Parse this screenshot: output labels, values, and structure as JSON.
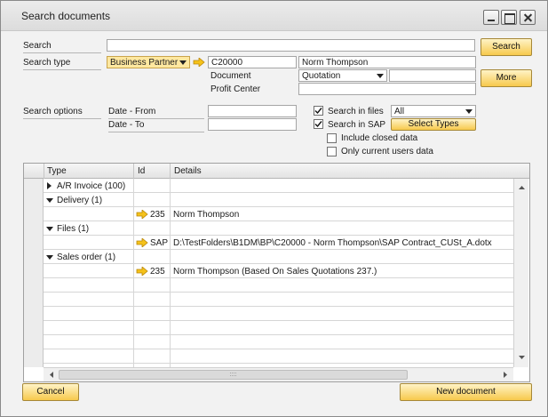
{
  "window": {
    "title": "Search documents"
  },
  "form": {
    "search_label": "Search",
    "search_value": "",
    "search_type_label": "Search type",
    "search_type_value": "Business Partner",
    "bp_code": "C20000",
    "bp_name": "Norm Thompson",
    "document_label": "Document",
    "document_value": "Quotation",
    "document_extra": "",
    "profit_center_label": "Profit Center",
    "profit_center_value": "",
    "search_options_label": "Search options",
    "date_from_label": "Date - From",
    "date_from_value": "",
    "date_to_label": "Date - To",
    "date_to_value": "",
    "search_in_files_label": "Search in files",
    "search_in_files_checked": true,
    "files_filter_value": "All",
    "search_in_sap_label": "Search in SAP",
    "search_in_sap_checked": true,
    "include_closed_label": "Include closed data",
    "include_closed_checked": false,
    "only_current_users_label": "Only current users data",
    "only_current_users_checked": false
  },
  "buttons": {
    "search": "Search",
    "more": "More",
    "select_types": "Select Types",
    "cancel": "Cancel",
    "new_document": "New document"
  },
  "grid": {
    "columns": [
      "Type",
      "Id",
      "Details"
    ],
    "rows": [
      {
        "kind": "group",
        "expanded": false,
        "type": "A/R Invoice (100)",
        "id": "",
        "details": ""
      },
      {
        "kind": "group",
        "expanded": true,
        "type": "Delivery (1)",
        "id": "",
        "details": ""
      },
      {
        "kind": "item",
        "type": "",
        "id": "235",
        "details": "Norm Thompson"
      },
      {
        "kind": "group",
        "expanded": true,
        "type": "Files (1)",
        "id": "",
        "details": ""
      },
      {
        "kind": "item",
        "type": "",
        "id": "SAP",
        "details": "D:\\TestFolders\\B1DM\\BP\\C20000 - Norm Thompson\\SAP Contract_CUSt_A.dotx"
      },
      {
        "kind": "group",
        "expanded": true,
        "type": "Sales order (1)",
        "id": "",
        "details": ""
      },
      {
        "kind": "item",
        "type": "",
        "id": "235",
        "details": "Norm Thompson (Based On Sales Quotations 237.)"
      }
    ],
    "scroll_grip": "::::"
  },
  "icons": [
    "link-arrow-icon",
    "dropdown-arrow-icon",
    "expand-triangle-icon",
    "collapse-triangle-icon",
    "checkbox-checked-icon"
  ],
  "colors": {
    "accent_button": "#f7c94c",
    "accent_border": "#a68838",
    "link_arrow": "#f0b400"
  }
}
